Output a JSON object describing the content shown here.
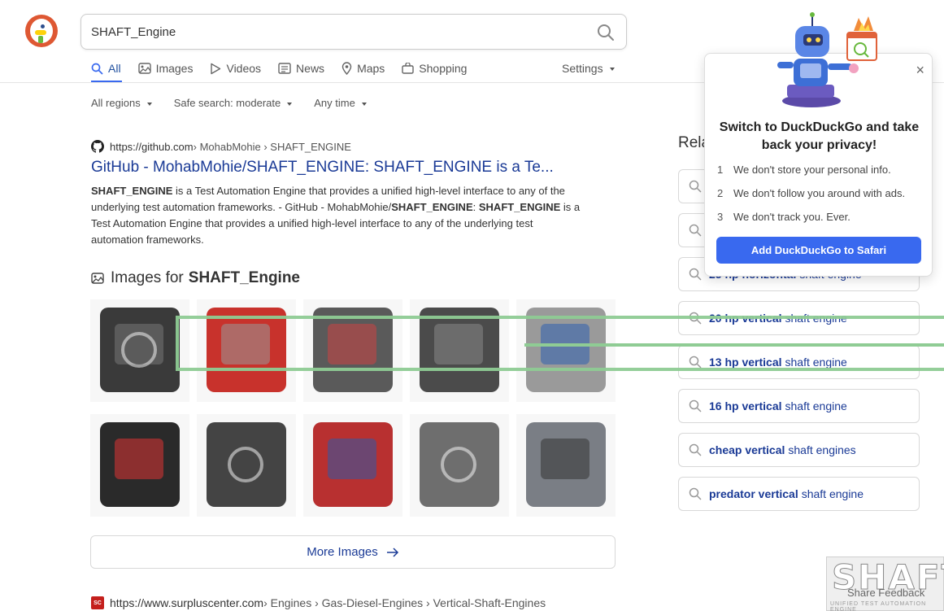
{
  "search": {
    "query": "SHAFT_Engine"
  },
  "nav": {
    "tabs": [
      {
        "label": "All",
        "icon": "search-icon"
      },
      {
        "label": "Images",
        "icon": "image-icon"
      },
      {
        "label": "Videos",
        "icon": "play-icon"
      },
      {
        "label": "News",
        "icon": "news-icon"
      },
      {
        "label": "Maps",
        "icon": "map-pin-icon"
      },
      {
        "label": "Shopping",
        "icon": "shopping-bag-icon"
      }
    ],
    "settings": "Settings"
  },
  "filters": {
    "region": "All regions",
    "safe_search": "Safe search: moderate",
    "time": "Any time"
  },
  "result1": {
    "domain": "https://github.com",
    "crumbs": " › MohabMohie › SHAFT_ENGINE",
    "title": "GitHub - MohabMohie/SHAFT_ENGINE: SHAFT_ENGINE is a Te...",
    "snip_b1": "SHAFT_ENGINE",
    "snip_t1": " is a Test Automation Engine that provides a unified high-level interface to any of the underlying test automation frameworks. - GitHub - MohabMohie/",
    "snip_b2": "SHAFT_ENGINE",
    "snip_t2": ":",
    "snip_b3": "SHAFT_ENGINE",
    "snip_t3": " is a Test Automation Engine that provides a unified high-level interface to any of the underlying test automation frameworks."
  },
  "images": {
    "heading_prefix": "Images for",
    "heading_query": "SHAFT_Engine",
    "more_label": "More Images"
  },
  "result2": {
    "domain": "https://www.surpluscenter.com",
    "crumbs": " › Engines › Gas-Diesel-Engines › Vertical-Shaft-Engines",
    "favicon_text": "SC"
  },
  "related": {
    "title": "Rela",
    "items": [
      {
        "bold": "",
        "text": ""
      },
      {
        "bold": "",
        "text": ""
      },
      {
        "bold": "25 hp horizontal",
        "text": "shaft engine"
      },
      {
        "bold": "20 hp vertical",
        "text": "shaft engine"
      },
      {
        "bold": "13 hp vertical",
        "text": "shaft engine"
      },
      {
        "bold": "16 hp vertical",
        "text": "shaft engine"
      },
      {
        "bold": "cheap vertical",
        "text": "shaft engines"
      },
      {
        "bold": "predator vertical",
        "text": "shaft engine"
      }
    ]
  },
  "popup": {
    "title": "Switch to DuckDuckGo and take back your privacy!",
    "points": [
      {
        "num": "1",
        "text": "We don't store your personal info."
      },
      {
        "num": "2",
        "text": "We don't follow you around with ads."
      },
      {
        "num": "3",
        "text": "We don't track you. Ever."
      }
    ],
    "cta": "Add DuckDuckGo to Safari",
    "close": "×"
  },
  "watermark": {
    "big": "SHAFT",
    "small": "UNIFIED TEST AUTOMATION ENGINE"
  },
  "feedback": "Share Feedback",
  "colors": {
    "accent": "#3969ef",
    "link": "#1a3a96",
    "brand": "#de5833"
  }
}
